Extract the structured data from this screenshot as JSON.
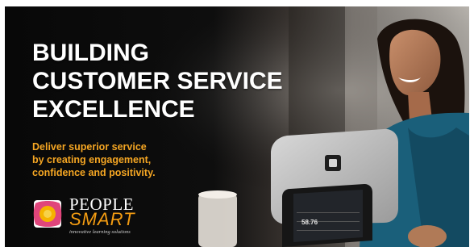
{
  "headline": {
    "lines": [
      "BUILDING",
      "CUSTOMER SERVICE",
      "EXCELLENCE"
    ]
  },
  "tagline": {
    "lines": [
      "Deliver superior service",
      "by creating engagement,",
      "confidence and positivity."
    ]
  },
  "logo": {
    "word1": "PEOPLE",
    "word2": "SMART",
    "subtitle": "innovative learning solutions"
  },
  "device": {
    "amount": "58.76"
  },
  "colors": {
    "background": "#0b0b0b",
    "headline": "#ffffff",
    "tagline": "#f5a623",
    "logo_accent": "#f39c12",
    "dress": "#1a5f7a"
  }
}
